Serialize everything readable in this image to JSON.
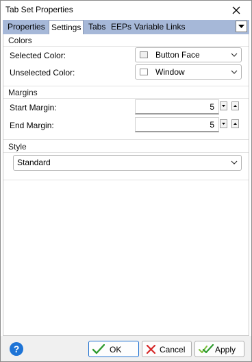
{
  "window": {
    "title": "Tab Set Properties",
    "close_icon": "close-icon"
  },
  "tabs": [
    {
      "label": "Properties",
      "active": false
    },
    {
      "label": "Settings",
      "active": true
    },
    {
      "label": "Tabs",
      "active": false
    },
    {
      "label": "EEPs",
      "active": false
    },
    {
      "label": "Variable Links",
      "active": false
    }
  ],
  "colors_group": {
    "title": "Colors",
    "selected_color_label": "Selected Color:",
    "selected_color_value": "Button Face",
    "selected_color_swatch": "#f0f0f0",
    "unselected_color_label": "Unselected Color:",
    "unselected_color_value": "Window",
    "unselected_color_swatch": "#ffffff"
  },
  "margins_group": {
    "title": "Margins",
    "start_margin_label": "Start Margin:",
    "start_margin_value": "5",
    "end_margin_label": "End Margin:",
    "end_margin_value": "5"
  },
  "style_group": {
    "title": "Style",
    "style_value": "Standard"
  },
  "footer": {
    "help_icon": "?",
    "ok_label": "OK",
    "cancel_label": "Cancel",
    "apply_label": "Apply"
  },
  "theme": {
    "tabstrip_bg": "#a6b8d8",
    "accent": "#1c6fd0"
  }
}
